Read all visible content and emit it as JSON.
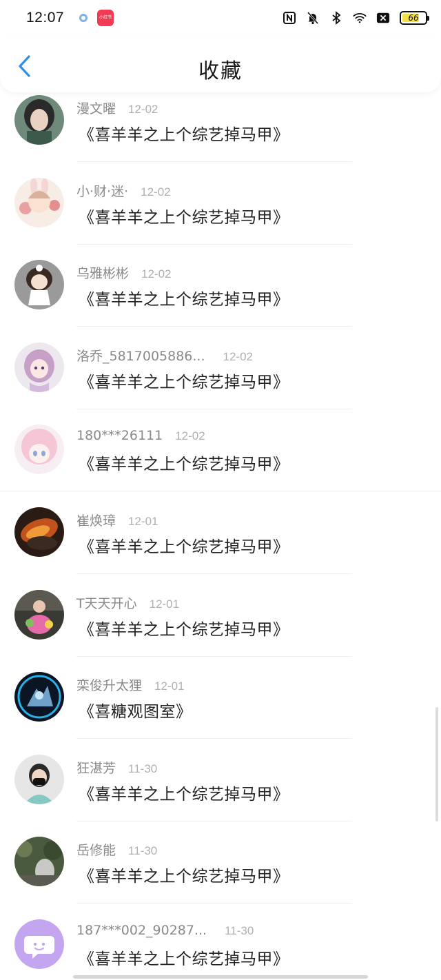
{
  "status_bar": {
    "time": "12:07",
    "app_badge": "小红书",
    "battery": "66"
  },
  "header": {
    "title": "收藏"
  },
  "items": [
    {
      "user": "漫文曜",
      "date": "12-02",
      "title": "《喜羊羊之上个综艺掉马甲》"
    },
    {
      "user": "小·财·迷·",
      "date": "12-02",
      "title": "《喜羊羊之上个综艺掉马甲》"
    },
    {
      "user": "乌雅彬彬",
      "date": "12-02",
      "title": "《喜羊羊之上个综艺掉马甲》"
    },
    {
      "user": "洛乔_5817005886...",
      "date": "12-02",
      "title": "《喜羊羊之上个综艺掉马甲》"
    },
    {
      "user": "180***26111",
      "date": "12-02",
      "title": "《喜羊羊之上个综艺掉马甲》"
    },
    {
      "user": "崔焕璋",
      "date": "12-01",
      "title": "《喜羊羊之上个综艺掉马甲》"
    },
    {
      "user": "T天天开心",
      "date": "12-01",
      "title": "《喜羊羊之上个综艺掉马甲》"
    },
    {
      "user": "栾俊升太狸",
      "date": "12-01",
      "title": "《喜糖观图室》"
    },
    {
      "user": "狂湛芳",
      "date": "11-30",
      "title": "《喜羊羊之上个综艺掉马甲》"
    },
    {
      "user": "岳修能",
      "date": "11-30",
      "title": "《喜羊羊之上个综艺掉马甲》"
    },
    {
      "user": "187***002_90287...",
      "date": "11-30",
      "title": "《喜羊羊之上个综艺掉马甲》"
    }
  ],
  "colors": {
    "accent": "#2f8fe6",
    "username": "#8a8a8a",
    "date": "#b0b0b0",
    "title": "#222222"
  }
}
